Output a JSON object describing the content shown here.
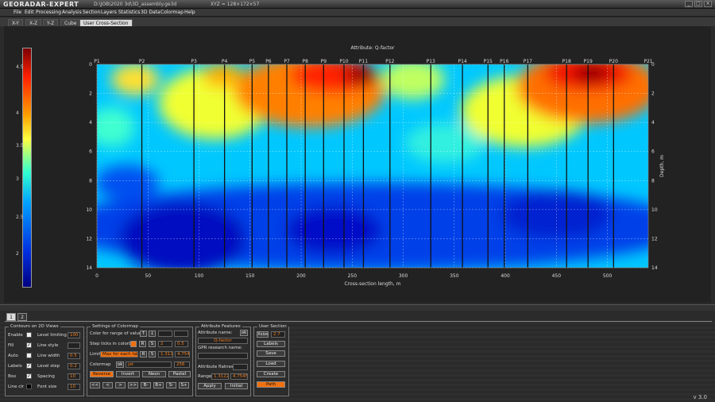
{
  "window": {
    "app_name": "GEORADAR-EXPERT",
    "path": "D:\\JOB\\2020 3d\\3D_assembly.ge3d",
    "xyz": "XYZ = 128×172×57",
    "version": "v 3.0"
  },
  "menu": [
    "File",
    "Edit",
    "Processing",
    "Analysis",
    "Section",
    "Layers",
    "Statistics",
    "3D Data",
    "Colormap",
    "Help"
  ],
  "view_tabs": [
    "X-Y",
    "X-Z",
    "Y-Z",
    "Cube",
    "User Cross-Section"
  ],
  "active_view_tab": 4,
  "page_tabs": [
    "1",
    "2"
  ],
  "chart_data": {
    "type": "heatmap",
    "title": "Attribute: Q-factor",
    "xlabel": "Cross-section length, m",
    "ylabel": "Depth, m",
    "xlim": [
      0,
      540
    ],
    "ylim": [
      0,
      14
    ],
    "xticks": [
      0,
      50,
      100,
      150,
      200,
      250,
      300,
      350,
      400,
      450,
      500
    ],
    "yticks": [
      0,
      2,
      4,
      6,
      8,
      10,
      12,
      14
    ],
    "grid": true,
    "colormap": "jet",
    "colorbar": {
      "ticks": [
        "4.5",
        "4",
        "3.5",
        "3",
        "2.5",
        "2"
      ],
      "min": 1.31225,
      "max": 4.75455
    },
    "profile_points": [
      {
        "label": "P1",
        "x": 0
      },
      {
        "label": "P2",
        "x": 44
      },
      {
        "label": "P3",
        "x": 95
      },
      {
        "label": "P4",
        "x": 125
      },
      {
        "label": "P5",
        "x": 152
      },
      {
        "label": "P6",
        "x": 168
      },
      {
        "label": "P7",
        "x": 186
      },
      {
        "label": "P8",
        "x": 204
      },
      {
        "label": "P9",
        "x": 222
      },
      {
        "label": "P10",
        "x": 242
      },
      {
        "label": "P11",
        "x": 261
      },
      {
        "label": "P12",
        "x": 287
      },
      {
        "label": "P13",
        "x": 327
      },
      {
        "label": "P14",
        "x": 358
      },
      {
        "label": "P15",
        "x": 383
      },
      {
        "label": "P16",
        "x": 399
      },
      {
        "label": "P17",
        "x": 422
      },
      {
        "label": "P18",
        "x": 460
      },
      {
        "label": "P19",
        "x": 481
      },
      {
        "label": "P20",
        "x": 506
      },
      {
        "label": "P21",
        "x": 540
      }
    ]
  },
  "panel_contours": {
    "title": "Contours on 2D Views",
    "items": [
      {
        "label": "Enable",
        "checked": false,
        "sub": "Level limiting",
        "value": "100"
      },
      {
        "label": "Fill",
        "checked": true,
        "sub": "Line style",
        "value": ""
      },
      {
        "label": "Auto",
        "checked": false,
        "sub": "Line width",
        "value": "0.5"
      },
      {
        "label": "Labels",
        "checked": true,
        "sub": "Level step",
        "value": "0.2"
      },
      {
        "label": "Box",
        "checked": true,
        "sub": "Spacing",
        "value": "10"
      },
      {
        "label": "Line clr",
        "checked": false,
        "sub": "Font size",
        "value": "10"
      }
    ]
  },
  "panel_colormap": {
    "title": "Settings of Colormap",
    "color_range_label": "Color for range of values",
    "step_ticks_label": "Step ticks in colorbar",
    "step_a": "2",
    "step_b": "0.5",
    "limit_label": "Limit",
    "limit_mode": "Max for each tab",
    "limit_min": "1.31225",
    "limit_max": "4.75455",
    "colormap_label": "Colormap",
    "colormap_value": "jet",
    "colormap_n": "256",
    "ok": "ok",
    "reset": "R",
    "set": "S",
    "buttons": [
      "Reverse",
      "Invert",
      "Neon",
      "Pastel"
    ],
    "nav": [
      "<<",
      "<",
      ">",
      ">>",
      "B-",
      "B+",
      "S-",
      "S+"
    ]
  },
  "panel_attr": {
    "title": "Attribute Features",
    "name_label": "Attribute name:",
    "name_value": "Q-factor",
    "gpr_label": "GPR research name:",
    "gpr_value": "",
    "flatness_label": "Attribute flatness",
    "range_label": "Range",
    "range_min": "1.31225",
    "range_max": "4.75455",
    "apply": "Apply",
    "initial": "Initial",
    "ok": "ok"
  },
  "panel_user": {
    "title": "User Section",
    "xsize_label": "Xsize",
    "xsize_value": "2.7",
    "buttons": [
      "Labels",
      "Save",
      "Load",
      "Create",
      "Path"
    ]
  }
}
